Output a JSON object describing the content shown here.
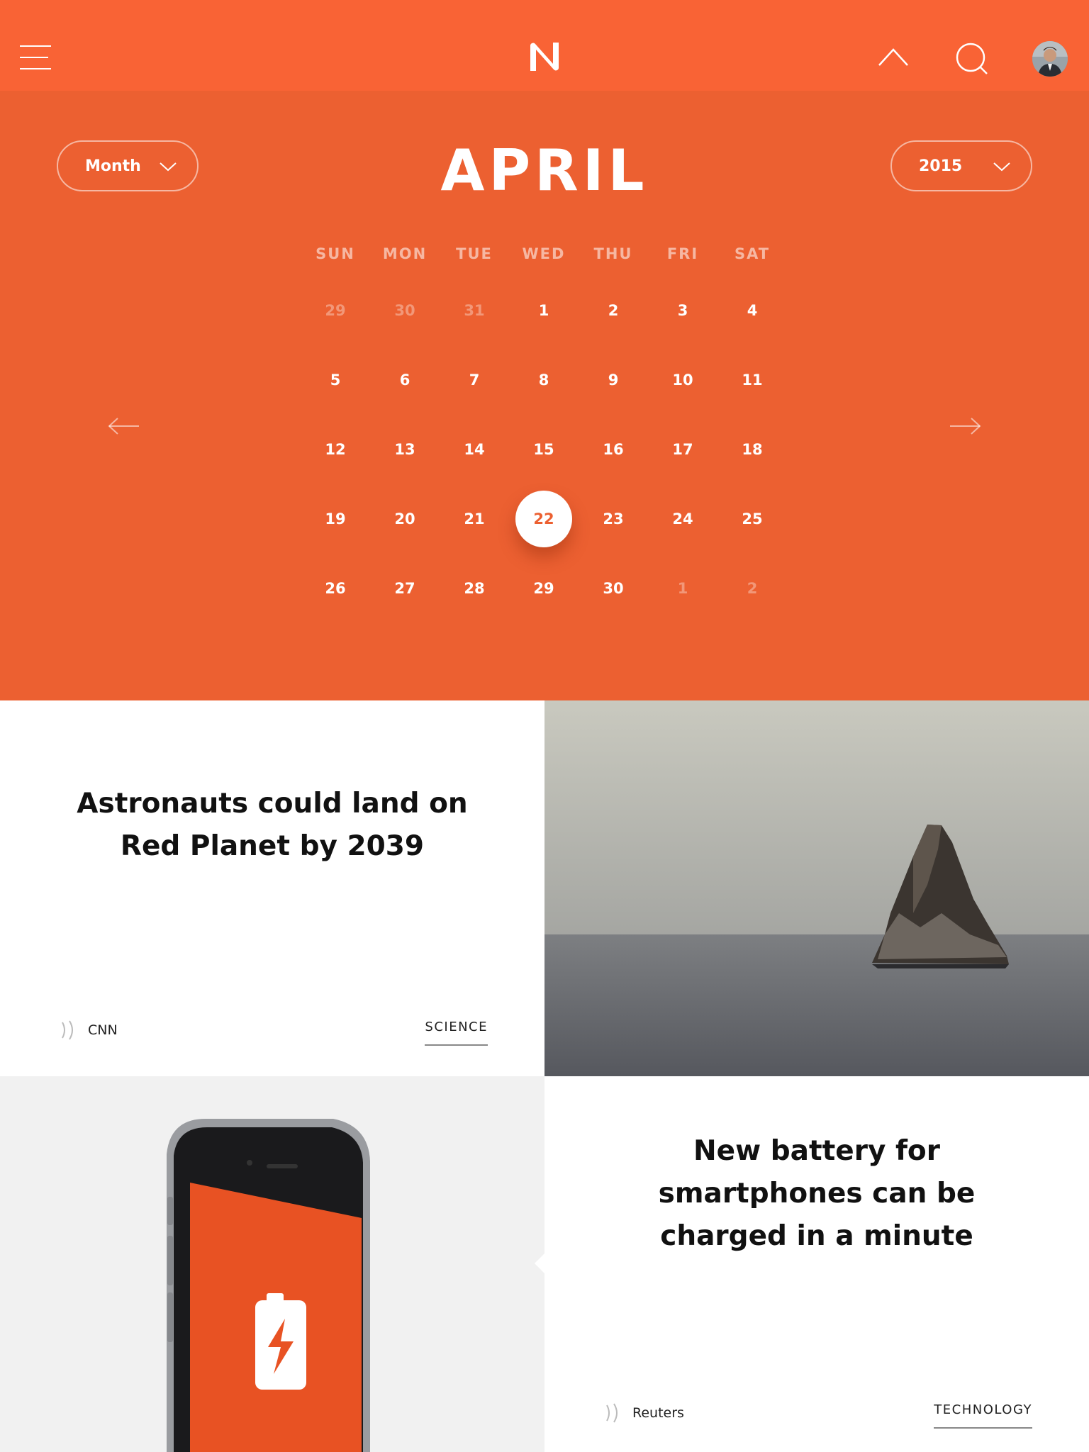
{
  "header": {
    "logo_letter": "N",
    "menu_icon": "hamburger-menu-icon",
    "up_icon": "chevron-up-icon",
    "search_icon": "search-icon",
    "avatar_icon": "user-avatar"
  },
  "calendar": {
    "month_selector": "Month",
    "year_selector": "2015",
    "title": "APRIL",
    "weekdays": [
      "SUN",
      "MON",
      "TUE",
      "WED",
      "THU",
      "FRI",
      "SAT"
    ],
    "weeks": [
      [
        {
          "d": "29",
          "muted": true
        },
        {
          "d": "30",
          "muted": true
        },
        {
          "d": "31",
          "muted": true
        },
        {
          "d": "1"
        },
        {
          "d": "2"
        },
        {
          "d": "3"
        },
        {
          "d": "4"
        }
      ],
      [
        {
          "d": "5"
        },
        {
          "d": "6"
        },
        {
          "d": "7"
        },
        {
          "d": "8"
        },
        {
          "d": "9"
        },
        {
          "d": "10"
        },
        {
          "d": "11"
        }
      ],
      [
        {
          "d": "12"
        },
        {
          "d": "13"
        },
        {
          "d": "14"
        },
        {
          "d": "15"
        },
        {
          "d": "16"
        },
        {
          "d": "17"
        },
        {
          "d": "18"
        }
      ],
      [
        {
          "d": "19"
        },
        {
          "d": "20"
        },
        {
          "d": "21"
        },
        {
          "d": "22",
          "selected": true
        },
        {
          "d": "23"
        },
        {
          "d": "24"
        },
        {
          "d": "25"
        }
      ],
      [
        {
          "d": "26"
        },
        {
          "d": "27"
        },
        {
          "d": "28"
        },
        {
          "d": "29"
        },
        {
          "d": "30"
        },
        {
          "d": "1",
          "muted": true
        },
        {
          "d": "2",
          "muted": true
        }
      ]
    ],
    "prev_icon": "arrow-left-icon",
    "next_icon": "arrow-right-icon"
  },
  "articles": [
    {
      "headline_line1": "Astronauts could land on",
      "headline_line2": "Red Planet by 2039",
      "source": "CNN",
      "category": "SCIENCE"
    },
    {
      "headline_line1": "New battery for",
      "headline_line2": "smartphones can be",
      "headline_line3": "charged in a minute",
      "source": "Reuters",
      "category": "TECHNOLOGY"
    }
  ],
  "colors": {
    "header_bg": "#f96335",
    "calendar_bg": "#ec6031",
    "accent": "#ec6031",
    "text_dark": "#111111"
  }
}
